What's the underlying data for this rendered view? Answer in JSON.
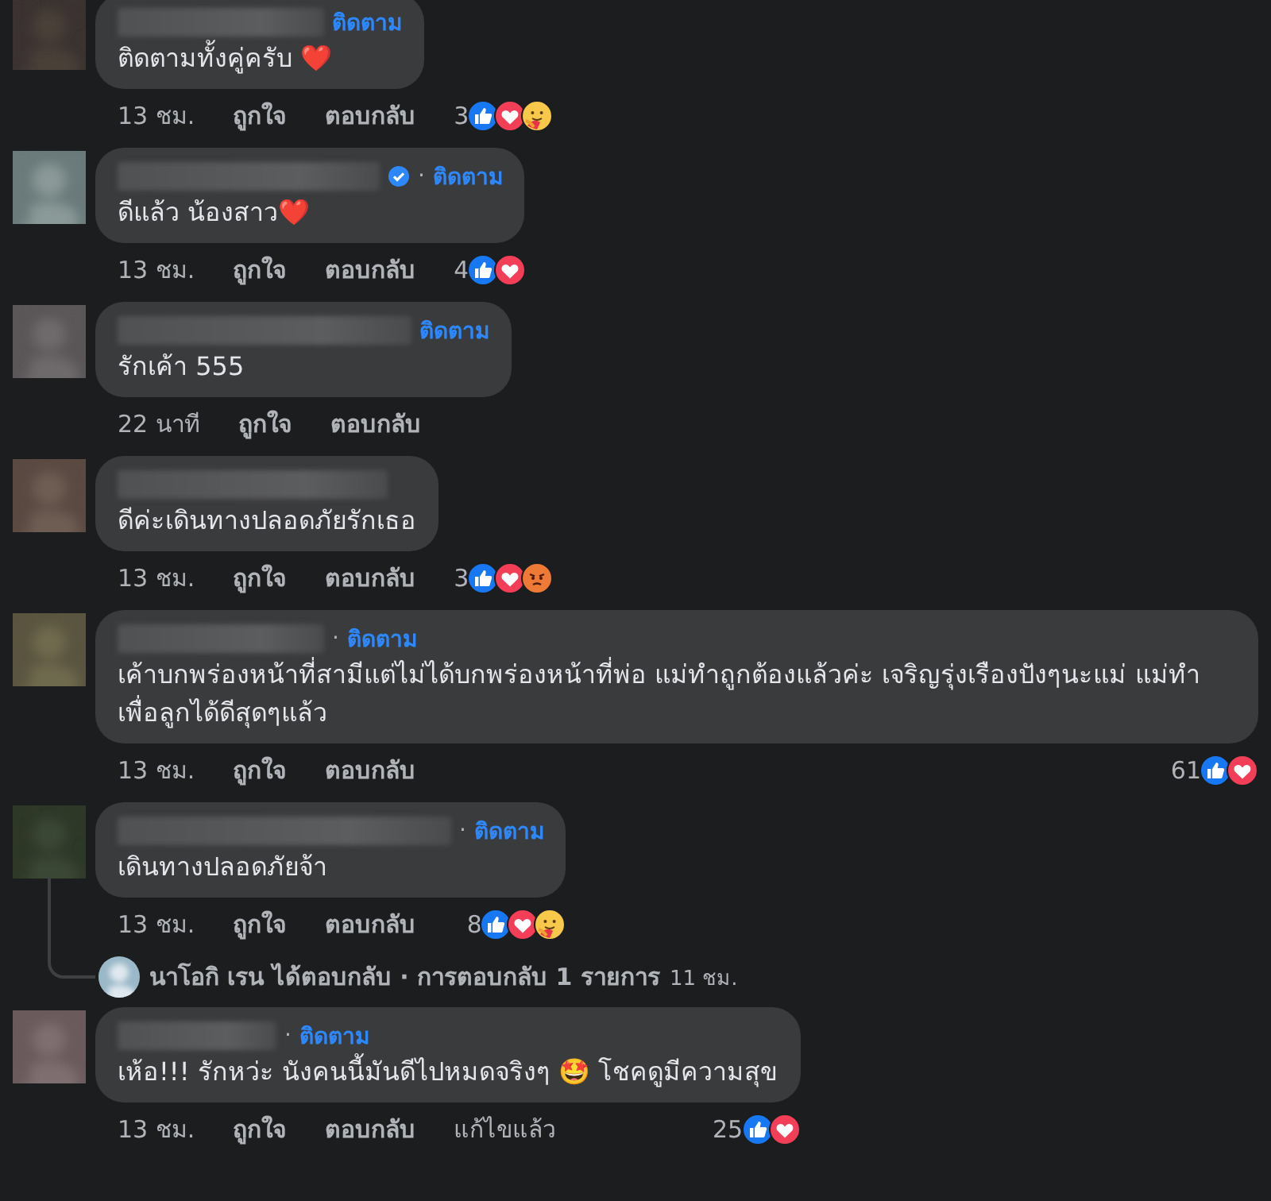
{
  "comments": [
    {
      "verified": false,
      "follow_label": "ติดตาม",
      "text": "ติดตามทั้งคู่ครับ ❤️",
      "time": "13 ชม.",
      "like_label": "ถูกใจ",
      "reply_label": "ตอบกลับ",
      "reaction_count": "3",
      "reactions": [
        {
          "kind": "like"
        },
        {
          "kind": "love"
        },
        {
          "kind": "care"
        }
      ]
    },
    {
      "verified": true,
      "follow_prefix": "·",
      "follow_label": "ติดตาม",
      "text": "ดีแล้ว น้องสาว❤️",
      "time": "13 ชม.",
      "like_label": "ถูกใจ",
      "reply_label": "ตอบกลับ",
      "reaction_count": "4",
      "reactions": [
        {
          "kind": "like"
        },
        {
          "kind": "love"
        }
      ]
    },
    {
      "verified": false,
      "follow_label": "ติดตาม",
      "text": "รักเค้า 555",
      "time": "22 นาที",
      "like_label": "ถูกใจ",
      "reply_label": "ตอบกลับ"
    },
    {
      "verified": false,
      "text": "ดีค่ะเดินทางปลอดภัยรักเธอ",
      "time": "13 ชม.",
      "like_label": "ถูกใจ",
      "reply_label": "ตอบกลับ",
      "reaction_count": "3",
      "reactions": [
        {
          "kind": "like"
        },
        {
          "kind": "love"
        },
        {
          "kind": "angry"
        }
      ]
    },
    {
      "verified": false,
      "follow_prefix": "·",
      "follow_label": "ติดตาม",
      "text": "เค้าบกพร่องหน้าที่สามีแต่ไม่ได้บกพร่องหน้าที่พ่อ แม่ทำถูกต้องแล้วค่ะ เจริญรุ่งเรืองปังๆนะแม่ แม่ทำเพื่อลูกได้ดีสุดๆแล้ว",
      "time": "13 ชม.",
      "like_label": "ถูกใจ",
      "reply_label": "ตอบกลับ",
      "reaction_count": "61",
      "reactions": [
        {
          "kind": "like"
        },
        {
          "kind": "love"
        }
      ]
    },
    {
      "verified": false,
      "follow_prefix": "·",
      "follow_label": "ติดตาม",
      "text": "เดินทางปลอดภัยจ้า",
      "time": "13 ชม.",
      "like_label": "ถูกใจ",
      "reply_label": "ตอบกลับ",
      "reaction_count": "8",
      "reactions": [
        {
          "kind": "like"
        },
        {
          "kind": "love"
        },
        {
          "kind": "care"
        }
      ],
      "replies": {
        "text": "นาโอกิ เรน ได้ตอบกลับ · การตอบกลับ 1 รายการ",
        "time": "11 ชม."
      }
    },
    {
      "verified": false,
      "follow_prefix": "·",
      "follow_label": "ติดตาม",
      "text": "เห้อ!!! รักหว่ะ นังคนนี้มันดีไปหมดจริงๆ 🤩 โชคดูมีความสุข",
      "time": "13 ชม.",
      "like_label": "ถูกใจ",
      "reply_label": "ตอบกลับ",
      "edited_label": "แก้ไขแล้ว",
      "reaction_count": "25",
      "reactions": [
        {
          "kind": "like"
        },
        {
          "kind": "love"
        }
      ]
    }
  ]
}
